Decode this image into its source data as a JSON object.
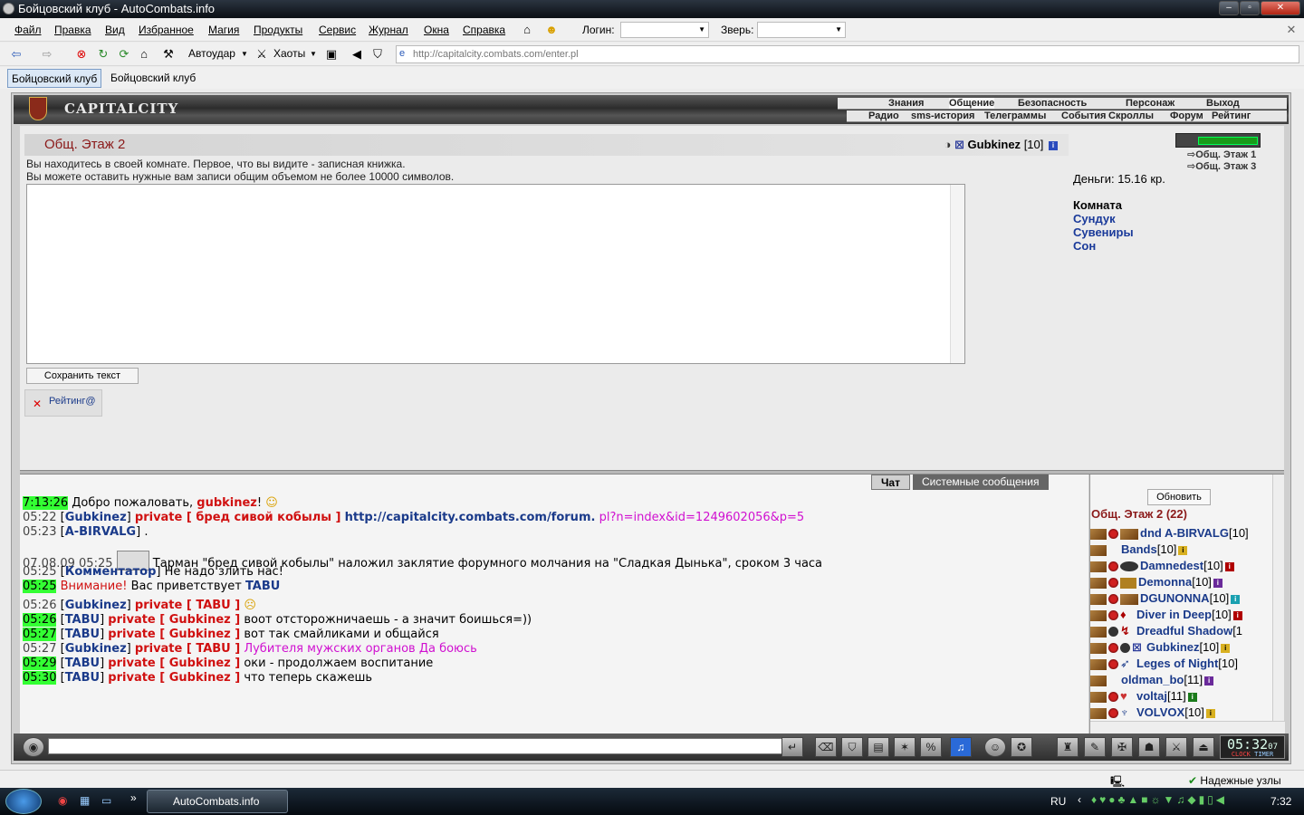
{
  "window": {
    "title": "Бойцовский клуб - AutoCombats.info"
  },
  "menu": {
    "items": [
      "Файл",
      "Правка",
      "Вид",
      "Избранное",
      "Магия",
      "Продукты",
      "Сервис",
      "Журнал",
      "Окна",
      "Справка"
    ],
    "login_label": "Логин:",
    "pet_label": "Зверь:"
  },
  "toolbar": {
    "autoudar": "Автоудар",
    "haoty": "Хаоты",
    "address": "http://capitalcity.combats.com/enter.pl"
  },
  "tabs": [
    "Бойцовский клуб",
    "Бойцовский клуб"
  ],
  "banner": {
    "logo": "CAPITALCITY",
    "nav_top": [
      "Знания",
      "Общение",
      "Безопасность",
      "Персонаж",
      "Выход"
    ],
    "nav_bottom": [
      "Радио",
      "sms-история",
      "Телеграммы",
      "События",
      "Скроллы",
      "Форум",
      "Рейтинг"
    ]
  },
  "room": {
    "title": "Общ. Этаж 2",
    "user": "Gubkinez",
    "user_level": "[10]",
    "desc1": "Вы находитесь в своей комнате. Первое, что вы видите - записная книжка.",
    "desc2": "Вы можете оставить нужные вам записи общим объемом не более 10000 символов.",
    "save_button": "Сохранить текст",
    "rating": "Рейтинг@"
  },
  "right": {
    "floor1": "Общ. Этаж 1",
    "floor3": "Общ. Этаж 3",
    "money": "Деньги: 15.16 кр.",
    "room_label": "Комната",
    "links": [
      "Сундук",
      "Сувениры",
      "Сон"
    ]
  },
  "chat": {
    "tab_chat": "Чат",
    "tab_sys": "Системные сообщения",
    "l1": {
      "t": "7:13:26",
      "a": "Добро пожаловать,",
      "n": "gubkinez",
      "b": "!"
    },
    "l2": {
      "t": "05:22",
      "n": "Gubkinez",
      "p": "private [ бред сивой кобылы ]",
      "u": "http://capitalcity.combats.com/forum.",
      "q": "pl?n=index&id=1249602056&p=5"
    },
    "l3": {
      "t": "05:23",
      "n": "A-BIRVALG",
      "b": "."
    },
    "l4": {
      "t": "07.08.09 05:25",
      "m": "Тарман \"бред сивой кобылы\" наложил заклятие форумного молчания на \"Сладкая Дынька\", сроком 3 часа"
    },
    "l5": {
      "t": "05:25",
      "n": "Комментатор",
      "m": "Не надо злить нас!"
    },
    "l6": {
      "t": "05:25",
      "w": "Внимание!",
      "m": "Вас приветствует",
      "n": "TABU"
    },
    "l7": {
      "t": "05:26",
      "n": "Gubkinez",
      "p": "private [ TABU ]"
    },
    "l8": {
      "t": "05:26",
      "n": "TABU",
      "p": "private [ Gubkinez ]",
      "m": "воот отсторожничаешь - а значит боишься=))"
    },
    "l9": {
      "t": "05:27",
      "n": "TABU",
      "p": "private [ Gubkinez ]",
      "m": "вот так смайликами и общайся"
    },
    "l10": {
      "t": "05:27",
      "n": "Gubkinez",
      "p": "private [ TABU ]",
      "m": "Лубителя мужских органов Да боюсь"
    },
    "l11": {
      "t": "05:29",
      "n": "TABU",
      "p": "private [ Gubkinez ]",
      "m": "оки - продолжаем воспитание"
    },
    "l12": {
      "t": "05:30",
      "n": "TABU",
      "p": "private [ Gubkinez ]",
      "m": "что теперь скажешь"
    }
  },
  "users": {
    "refresh": "Обновить",
    "title": "Общ. Этаж 2 (22)",
    "list": [
      {
        "n": "dnd A-BIRVALG",
        "l": "[10]"
      },
      {
        "n": "Bands",
        "l": "[10]"
      },
      {
        "n": "Damnedest",
        "l": "[10]"
      },
      {
        "n": "Demonna",
        "l": "[10]"
      },
      {
        "n": "DGUNONNA",
        "l": "[10]"
      },
      {
        "n": "Diver in Deep",
        "l": "[10]"
      },
      {
        "n": "Dreadful Shadow",
        "l": "[1"
      },
      {
        "n": "Gubkinez",
        "l": "[10]"
      },
      {
        "n": "Leges of Night",
        "l": "[10]"
      },
      {
        "n": "oldman_bo",
        "l": "[11]"
      },
      {
        "n": "voltaj",
        "l": "[11]"
      },
      {
        "n": "VOLVOX",
        "l": "[10]"
      }
    ]
  },
  "clock": {
    "time": "05:32",
    "sec": "07",
    "l1": "CLOCK",
    "l2": "TIMER"
  },
  "status": {
    "text": "Надежные узлы"
  },
  "taskbar": {
    "task": "AutoCombats.info",
    "lang": "RU",
    "time": "7:32"
  }
}
